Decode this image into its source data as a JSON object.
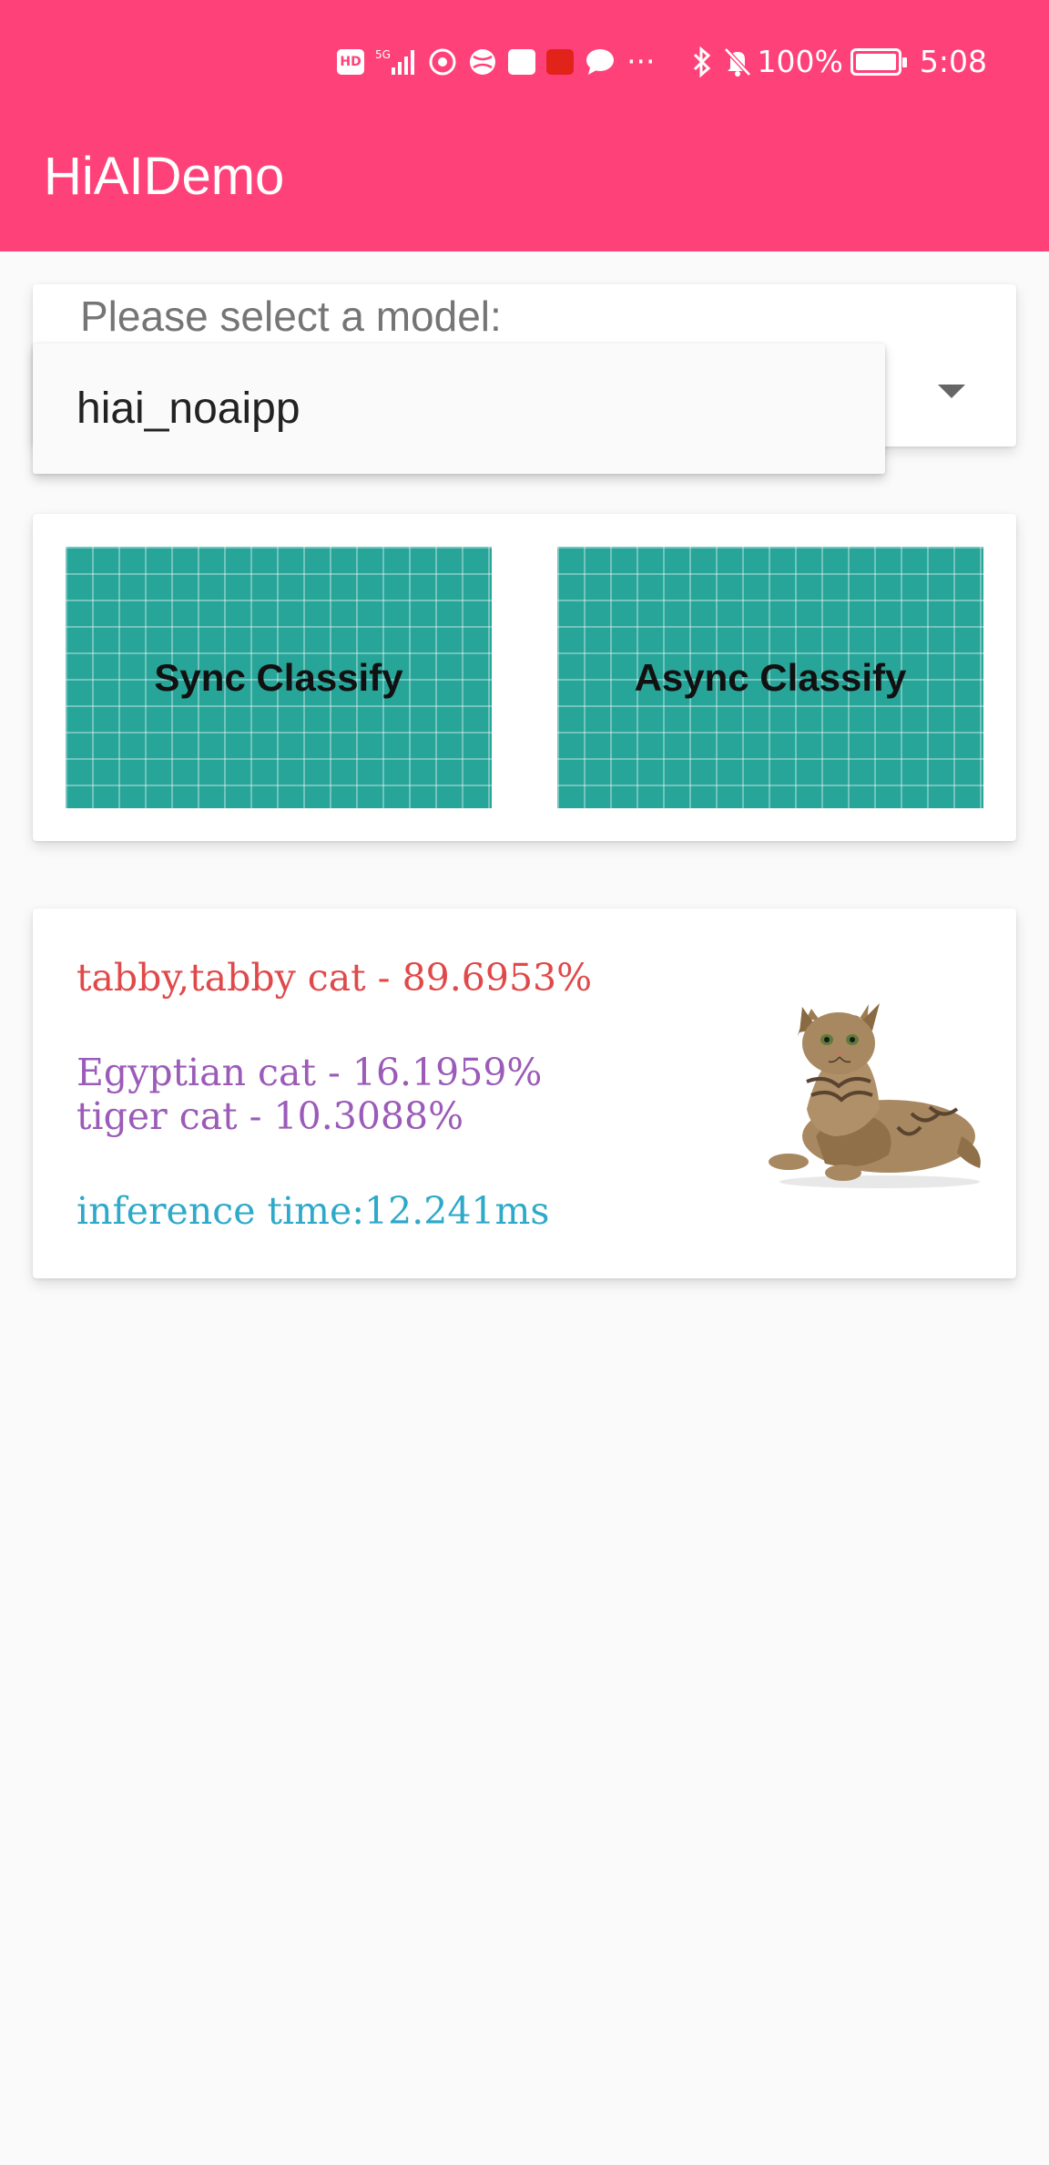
{
  "status_bar": {
    "icons": [
      "hd-icon",
      "5g-signal-icon",
      "browser-icon",
      "ball-icon",
      "huawei-store-icon",
      "app-icon",
      "chat-icon",
      "more-icon",
      "bluetooth-icon",
      "mute-icon"
    ],
    "hd_label": "HD",
    "more": "···",
    "battery_percent": "100%",
    "time": "5:08"
  },
  "app_bar": {
    "title": "HiAIDemo"
  },
  "model_selector": {
    "label": "Please select a model:",
    "selected": "hiai_noaipp"
  },
  "buttons": {
    "sync_label": "Sync Classify",
    "async_label": "Async Classify"
  },
  "results": {
    "top1": "tabby,tabby cat - 89.6953%",
    "top2": "Egyptian cat - 16.1959%",
    "top3": "tiger cat - 10.3088%",
    "inference_time": "inference time:12.241ms"
  },
  "colors": {
    "accent": "#ff4179",
    "button": "#27a599",
    "top1": "#e0494a",
    "others": "#9b5bb8",
    "time": "#2ea9c9"
  }
}
